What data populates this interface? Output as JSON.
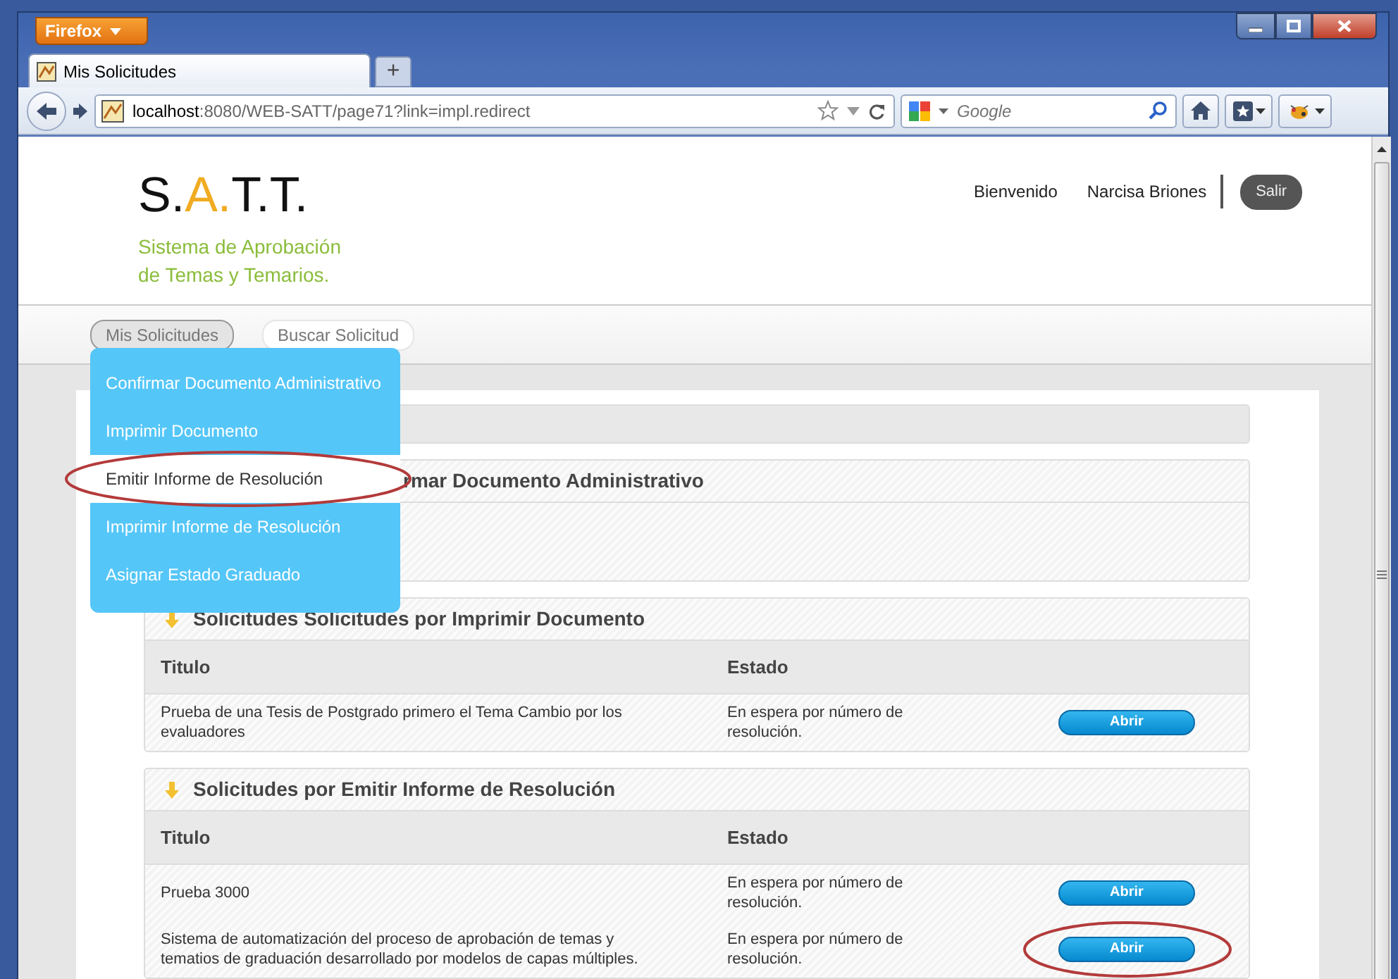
{
  "browser": {
    "menu_button": "Firefox",
    "tabs": [
      {
        "title": "Mis Solicitudes",
        "selected": true
      }
    ],
    "new_tab": "+",
    "url": {
      "host": "localhost",
      "path": ":8080/WEB-SATT/page71?link=impl.redirect"
    },
    "search": {
      "placeholder": "Google"
    }
  },
  "header": {
    "logo": [
      {
        "text": "S.",
        "accent": false
      },
      {
        "text": "A.",
        "accent": true
      },
      {
        "text": "T.T.",
        "accent": false
      }
    ],
    "subtitle": [
      "Sistema de Aprobación",
      "de Temas y Temarios."
    ],
    "welcome": "Bienvenido",
    "user": "Narcisa Briones",
    "logout": "Salir"
  },
  "nav": [
    {
      "label": "Mis Solicitudes",
      "selected": true
    },
    {
      "label": "Buscar Solicitud",
      "selected": false
    }
  ],
  "dropdown": [
    {
      "label": "Confirmar Documento Administrativo",
      "highlighted": false
    },
    {
      "label": "Imprimir Documento",
      "highlighted": false
    },
    {
      "label": "Emitir Informe de Resolución",
      "highlighted": true
    },
    {
      "label": "Imprimir Informe de Resolución",
      "highlighted": false
    },
    {
      "label": "Asignar Estado Graduado",
      "highlighted": false
    }
  ],
  "panels": [
    {
      "kind": "bar"
    },
    {
      "kind": "covered",
      "title": "rmar Documento Administrativo"
    },
    {
      "kind": "table",
      "title": "Solicitudes Solicitudes por Imprimir Documento",
      "arrow": true,
      "columns": [
        "Titulo",
        "Estado"
      ],
      "rows": [
        {
          "title": "Prueba de una Tesis de Postgrado primero el Tema Cambio por los evaluadores",
          "status": "En espera por número de resolución.",
          "button": "Abrir",
          "highlighted": false
        }
      ]
    },
    {
      "kind": "table",
      "title": "Solicitudes por Emitir Informe de Resolución",
      "arrow": true,
      "columns": [
        "Titulo",
        "Estado"
      ],
      "rows": [
        {
          "title": "Prueba 3000",
          "status": "En espera por número de resolución.",
          "button": "Abrir",
          "highlighted": false
        },
        {
          "title": "Sistema de automatización del proceso de aprobación de temas y tematios de graduación desarrollado por modelos de capas múltiples.",
          "status": "En espera por número de resolución.",
          "button": "Abrir",
          "highlighted": true
        }
      ]
    }
  ]
}
